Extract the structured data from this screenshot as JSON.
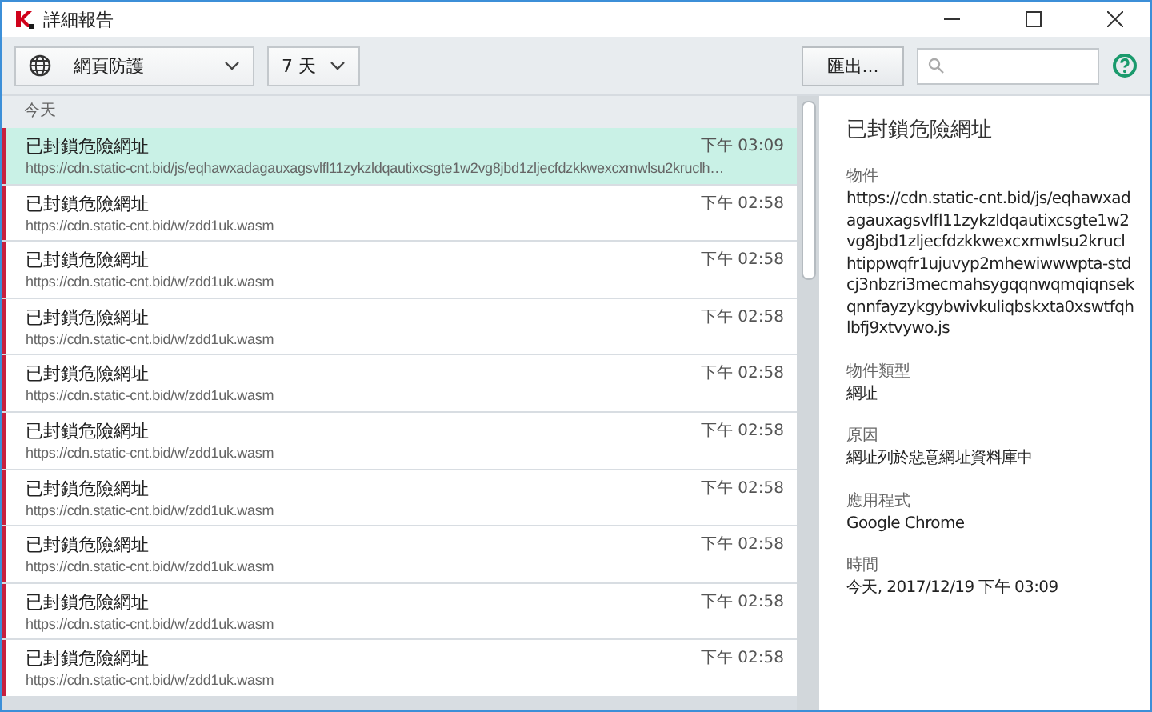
{
  "window": {
    "title": "詳細報告"
  },
  "toolbar": {
    "component_filter": "網頁防護",
    "period_filter": "7 天",
    "export_button": "匯出..."
  },
  "list": {
    "group_header": "今天",
    "rows": [
      {
        "title": "已封鎖危險網址",
        "url": "https://cdn.static-cnt.bid/js/eqhawxadagauxagsvlfl11zykzldqautixcsgte1w2vg8jbd1zljecfdzkkwexcxmwlsu2kruclh…",
        "time": "下午 03:09",
        "selected": true
      },
      {
        "title": "已封鎖危險網址",
        "url": "https://cdn.static-cnt.bid/w/zdd1uk.wasm",
        "time": "下午 02:58",
        "selected": false
      },
      {
        "title": "已封鎖危險網址",
        "url": "https://cdn.static-cnt.bid/w/zdd1uk.wasm",
        "time": "下午 02:58",
        "selected": false
      },
      {
        "title": "已封鎖危險網址",
        "url": "https://cdn.static-cnt.bid/w/zdd1uk.wasm",
        "time": "下午 02:58",
        "selected": false
      },
      {
        "title": "已封鎖危險網址",
        "url": "https://cdn.static-cnt.bid/w/zdd1uk.wasm",
        "time": "下午 02:58",
        "selected": false
      },
      {
        "title": "已封鎖危險網址",
        "url": "https://cdn.static-cnt.bid/w/zdd1uk.wasm",
        "time": "下午 02:58",
        "selected": false
      },
      {
        "title": "已封鎖危險網址",
        "url": "https://cdn.static-cnt.bid/w/zdd1uk.wasm",
        "time": "下午 02:58",
        "selected": false
      },
      {
        "title": "已封鎖危險網址",
        "url": "https://cdn.static-cnt.bid/w/zdd1uk.wasm",
        "time": "下午 02:58",
        "selected": false
      },
      {
        "title": "已封鎖危險網址",
        "url": "https://cdn.static-cnt.bid/w/zdd1uk.wasm",
        "time": "下午 02:58",
        "selected": false
      },
      {
        "title": "已封鎖危險網址",
        "url": "https://cdn.static-cnt.bid/w/zdd1uk.wasm",
        "time": "下午 02:58",
        "selected": false
      }
    ]
  },
  "detail": {
    "title": "已封鎖危險網址",
    "fields": [
      {
        "label": "物件",
        "value": "https://cdn.static-cnt.bid/js/eqhawxadagauxagsvlfl11zykzldqautixcsgte1w2vg8jbd1zljecfdzkkwexcxmwlsu2kruclhtippwqfr1ujuvyp2mhewiwwwpta-stdcj3nbzri3mecmahsygqqnwqmqiqnsekqnnfayzykgybwivkuliqbskxta0xswtfqhlbfj9xtvywo.js"
      },
      {
        "label": "物件類型",
        "value": "網址"
      },
      {
        "label": "原因",
        "value": "網址列於惡意網址資料庫中"
      },
      {
        "label": "應用程式",
        "value": "Google Chrome"
      },
      {
        "label": "時間",
        "value": "今天, 2017/12/19 下午 03:09"
      }
    ]
  }
}
